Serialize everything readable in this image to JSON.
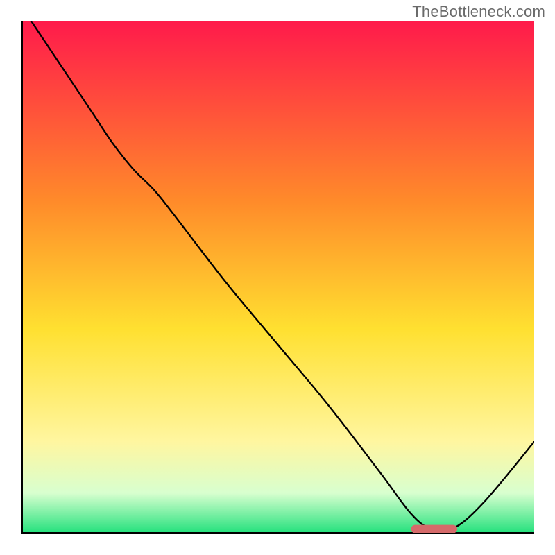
{
  "watermark": "TheBottleneck.com",
  "colors": {
    "gradient_top": "#ff1a4b",
    "gradient_upper_mid": "#ff8a2a",
    "gradient_mid": "#ffe030",
    "gradient_lower_mid": "#fff6a0",
    "gradient_bottom_light": "#d8ffcf",
    "gradient_bottom": "#1ee07a",
    "curve": "#000000",
    "marker": "#d56a6a",
    "axes": "#000000"
  },
  "chart_data": {
    "type": "line",
    "title": "",
    "xlabel": "",
    "ylabel": "",
    "xlim": [
      0,
      100
    ],
    "ylim": [
      0,
      100
    ],
    "x": [
      2,
      6,
      10,
      14,
      18,
      22,
      26,
      30,
      40,
      50,
      60,
      70,
      76,
      80,
      84,
      90,
      100
    ],
    "values": [
      100,
      94,
      88,
      82,
      76,
      71,
      67,
      62,
      49,
      37,
      25,
      12,
      4,
      1,
      1,
      6,
      18
    ],
    "annotations": [
      {
        "type": "marker_segment",
        "x_start": 76,
        "x_end": 85,
        "y": 1
      }
    ],
    "notes": "Values estimated from pixel positions; y=0 is bottom axis, y=100 is top of plot area. Curve starts at top-left, descends with a slight slope change around x≈26, reaches a flat minimum near x≈78–85 (marked in salmon), then rises toward the right edge. Background is a vertical red→orange→yellow→pale-yellow→pale-green→green gradient."
  }
}
